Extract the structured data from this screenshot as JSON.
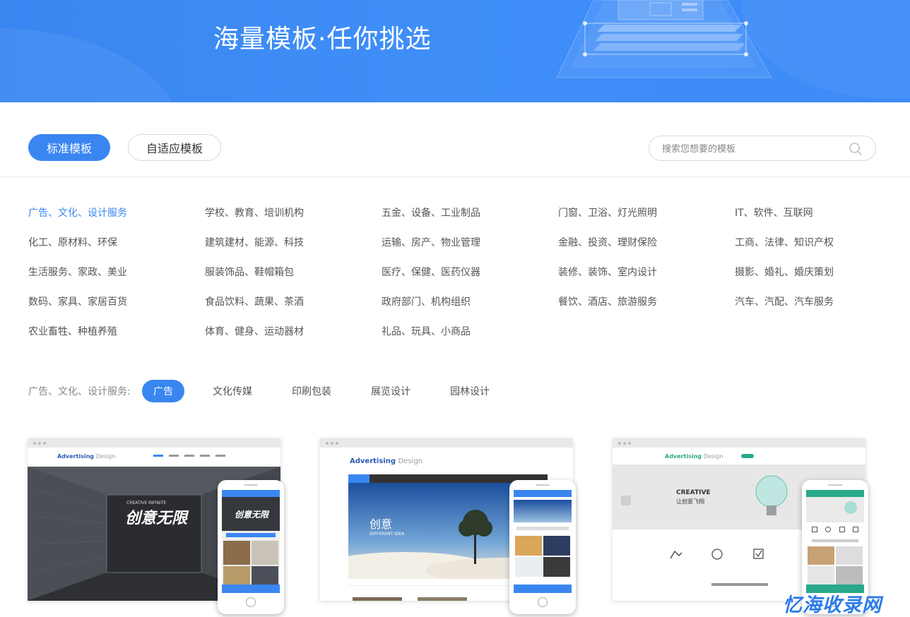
{
  "banner": {
    "title": "海量模板·任你挑选"
  },
  "tabs": [
    {
      "label": "标准模板",
      "active": true
    },
    {
      "label": "自适应模板",
      "active": false
    }
  ],
  "search": {
    "placeholder": "搜索您想要的模板"
  },
  "categories": [
    "广告、文化、设计服务",
    "学校、教育、培训机构",
    "五金、设备、工业制品",
    "门窗、卫浴、灯光照明",
    "IT、软件、互联网",
    "化工、原材料、环保",
    "建筑建材、能源、科技",
    "运输、房产、物业管理",
    "金融、投资、理财保险",
    "工商、法律、知识产权",
    "生活服务、家政、美业",
    "服装饰品、鞋帽箱包",
    "医疗、保健、医药仪器",
    "装修、装饰、室内设计",
    "摄影、婚礼、婚庆策划",
    "数码、家具、家居百货",
    "食品饮料、蔬果、茶酒",
    "政府部门、机构组织",
    "餐饮、酒店、旅游服务",
    "汽车、汽配、汽车服务",
    "农业畜牲、种植养殖",
    "体育、健身、运动器材",
    "礼品、玩具、小商品"
  ],
  "active_category_index": 0,
  "subfilter": {
    "label": "广告、文化、设计服务:",
    "items": [
      "广告",
      "文化传媒",
      "印刷包装",
      "展览设计",
      "园林设计"
    ],
    "active_index": 0
  },
  "cards": [
    {
      "logo_main": "Advertising",
      "logo_sub": "Design",
      "hero_text": "创意无限",
      "hero_sub": "CREATIVE INFINITE"
    },
    {
      "logo_main": "Advertising",
      "logo_sub": "Design",
      "hero_text": "创意",
      "hero_sub": "DIFFERENT IDEA"
    },
    {
      "logo_main": "Advertising",
      "logo_sub": "Design",
      "hero_text": "CREATIVE",
      "hero_sub": "让创意飞翔"
    }
  ],
  "watermark": "忆海收录网",
  "colors": {
    "accent": "#3a86f1",
    "banner": "#3d8bf7"
  }
}
